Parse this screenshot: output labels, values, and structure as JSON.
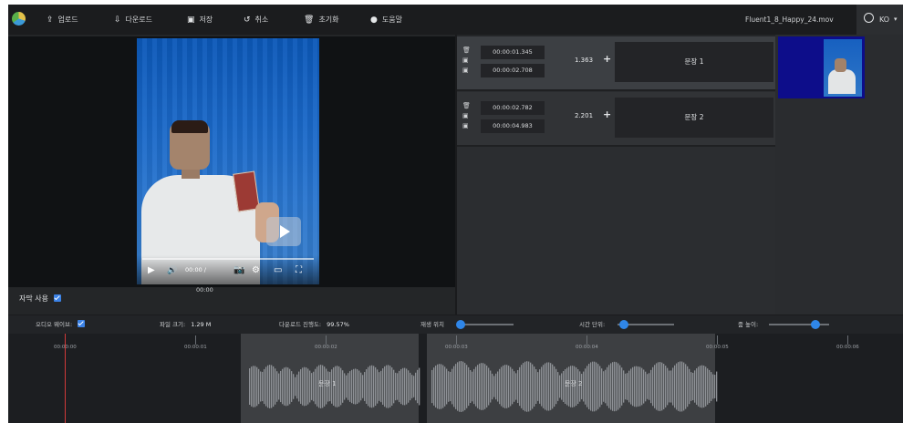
{
  "toolbar": {
    "upload": "업로드",
    "download": "다운로드",
    "save": "저장",
    "cancel": "취소",
    "initialize": "초기화",
    "help": "도움말",
    "filename": "Fluent1_8_Happy_24.mov",
    "language": "KO"
  },
  "video": {
    "time": "00:00 /",
    "time_below": "00:00"
  },
  "subtitle_use": "자막 사용",
  "sentences": [
    {
      "start": "00:00:01.345",
      "end": "00:00:02.708",
      "duration": "1.363",
      "text": "문장 1"
    },
    {
      "start": "00:00:02.782",
      "end": "00:00:04.983",
      "duration": "2.201",
      "text": "문장 2"
    }
  ],
  "controls": {
    "audio_waveform_label": "오디오 웨이브:",
    "file_size_label": "파일 크기:",
    "file_size_value": "1.29 M",
    "loading_label": "다운로드 진행도:",
    "loading_value": "99.57%",
    "playback_position_label": "재생 위치",
    "time_unit_label": "시간 단위:",
    "zoom_label": "줌 높이:"
  },
  "timeline": {
    "ticks": [
      "00:00:00",
      "00:00:01",
      "00:00:02",
      "00:00:03",
      "00:00:04",
      "00:00:05",
      "00:00:06"
    ],
    "segments": [
      "문장 1",
      "문장 2"
    ]
  }
}
